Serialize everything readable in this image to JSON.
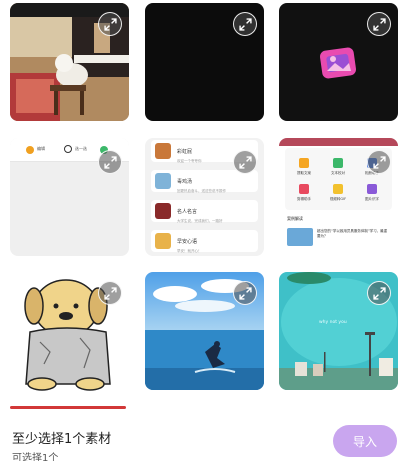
{
  "grid": {
    "tiles": [
      {
        "id": "piano-dog",
        "kind": "photo"
      },
      {
        "id": "black-screen",
        "kind": "video"
      },
      {
        "id": "pink-app-icon",
        "kind": "image"
      },
      {
        "id": "app-toolbar-screenshot",
        "kind": "screenshot",
        "toolbar": {
          "left_label": "编辑",
          "mid_label": "选一选"
        }
      },
      {
        "id": "list-screenshot",
        "kind": "screenshot",
        "items": [
          {
            "title": "彩虹屁",
            "sub": "欢迎一个夸夸你"
          },
          {
            "title": "毒鸡汤",
            "sub": "回更热血奋斗，送这些说不振作"
          },
          {
            "title": "名人名言",
            "sub": "大学生说，完成我们，一路好"
          },
          {
            "title": "早安心语",
            "sub": "早安！就开心！"
          }
        ]
      },
      {
        "id": "tools-screenshot",
        "kind": "screenshot",
        "grid_labels": [
          "提取文案",
          "文本校对",
          "相册助手",
          "剪辑助手",
          "视频转GIF",
          "图片识字"
        ],
        "section_title": "案例解读",
        "card_text": "超出您的“学以致用员具服务体制”学习，最重要为？"
      },
      {
        "id": "cartoon-dog",
        "kind": "image"
      },
      {
        "id": "surfer-sea",
        "kind": "image"
      },
      {
        "id": "teal-lake",
        "kind": "image",
        "overlay_text": "why not you"
      }
    ]
  },
  "footer": {
    "hint": "至少选择1个素材",
    "sub": "可选择1个",
    "import_label": "导入"
  },
  "colors": {
    "import_button": "#c9a6ef",
    "accent_pink": "#e94bb0"
  },
  "icons": {
    "expand": "expand-arrows-icon"
  }
}
